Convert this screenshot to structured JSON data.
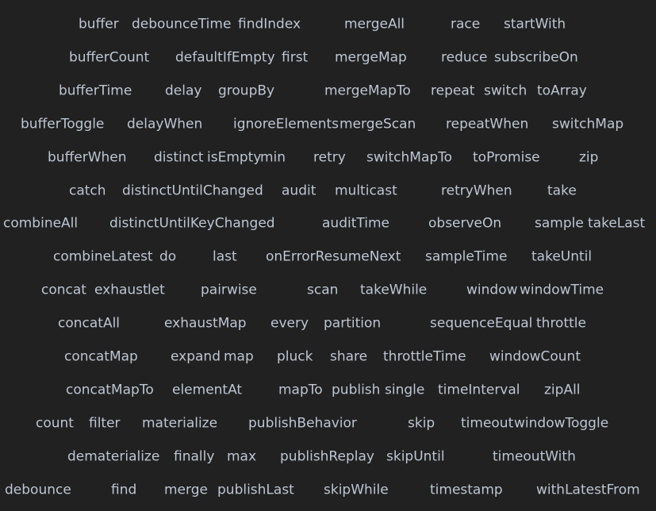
{
  "colors": {
    "background": "#212121",
    "text": "#bcc6d4"
  },
  "rows": [
    [
      "buffer",
      "debounceTime",
      "findIndex",
      "mergeAll",
      "race",
      "startWith"
    ],
    [
      "bufferCount",
      "defaultIfEmpty",
      "first",
      "mergeMap",
      "reduce",
      "subscribeOn"
    ],
    [
      "bufferTime",
      "delay",
      "groupBy",
      "mergeMapTo",
      "repeat",
      "switch",
      "toArray"
    ],
    [
      "bufferToggle",
      "delayWhen",
      "ignoreElements",
      "mergeScan",
      "repeatWhen",
      "switchMap"
    ],
    [
      "bufferWhen",
      "distinct",
      "isEmpty",
      "min",
      "retry",
      "switchMapTo",
      "toPromise",
      "zip"
    ],
    [
      "catch",
      "distinctUntilChanged",
      "audit",
      "multicast",
      "retryWhen",
      "take"
    ],
    [
      "combineAll",
      "distinctUntilKeyChanged",
      "auditTime",
      "observeOn",
      "sample",
      "takeLast"
    ],
    [
      "combineLatest",
      "do",
      "last",
      "onErrorResumeNext",
      "sampleTime",
      "takeUntil"
    ],
    [
      "concat",
      "exhaust",
      "let",
      "pairwise",
      "scan",
      "takeWhile",
      "window",
      "windowTime"
    ],
    [
      "concatAll",
      "exhaustMap",
      "every",
      "partition",
      "sequenceEqual",
      "throttle"
    ],
    [
      "concatMap",
      "expand",
      "map",
      "pluck",
      "share",
      "throttleTime",
      "windowCount"
    ],
    [
      "concatMapTo",
      "elementAt",
      "mapTo",
      "publish",
      "single",
      "timeInterval",
      "zipAll"
    ],
    [
      "count",
      "filter",
      "materialize",
      "publishBehavior",
      "skip",
      "timeout",
      "windowToggle"
    ],
    [
      "dematerialize",
      "finally",
      "max",
      "publishReplay",
      "skipUntil",
      "timeoutWith"
    ],
    [
      "debounce",
      "find",
      "merge",
      "publishLast",
      "skipWhile",
      "timestamp",
      "withLatestFrom"
    ]
  ]
}
